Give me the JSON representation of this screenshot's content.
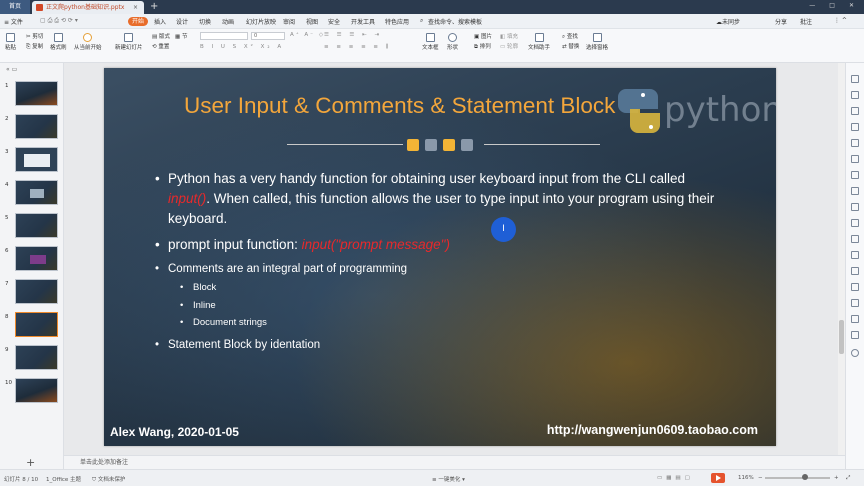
{
  "tabs": {
    "home": "首页",
    "document": "正文爬python基础知识.pptx"
  },
  "menu": {
    "file": "≡ 文件",
    "items": [
      "开始",
      "插入",
      "设计",
      "切换",
      "动画",
      "幻灯片放映",
      "审阅",
      "视图",
      "安全",
      "开发工具",
      "特色应用"
    ],
    "search": "查找命令、搜索模板",
    "sync": "未同步",
    "share": "分享",
    "annotate": "批注"
  },
  "ribbon": {
    "paste": "粘贴",
    "cut": "剪切",
    "copy": "复制",
    "format_painter": "格式刷",
    "from_current": "从当前开始",
    "new_slide": "新建幻灯片",
    "layout": "版式",
    "reset": "重置",
    "section": "节",
    "font_size": "0",
    "textbox": "文本框",
    "shape": "形状",
    "arrange": "排列",
    "picture": "图片",
    "fill": "填充",
    "outline": "轮廓",
    "doc_helper": "文档助手",
    "find_replace": "查找",
    "replace": "替换",
    "select_pane": "选择窗格"
  },
  "thumbnails": [
    "1",
    "2",
    "3",
    "4",
    "5",
    "6",
    "7",
    "8",
    "9",
    "10"
  ],
  "slide": {
    "title": "User Input & Comments & Statement Block",
    "python_word": "python",
    "bullet1_a": "Python has a very handy function for obtaining user keyboard input from the CLI called",
    "bullet1_red": "input()",
    "bullet1_b": ". When called, this function allows the user to type input into your program using their",
    "bullet1_c": "keyboard.",
    "bullet2_a": "prompt input function: ",
    "bullet2_red": "input(\"prompt message\")",
    "bullet3": "Comments are an integral part of programming",
    "sub1": "Block",
    "sub2": "Inline",
    "sub3": "Document strings",
    "bullet4": "Statement Block by identation",
    "footer_left": "Alex Wang,  2020-01-05",
    "footer_right": "http://wangwenjun0609.taobao.com",
    "cursor": "I",
    "colors": {
      "title": "#f3a63b",
      "red": "#e8292b",
      "square_gold": "#f3b436",
      "square_gray": "#8a99aa"
    }
  },
  "notes_placeholder": "单击此处添加备注",
  "status": {
    "slide_count": "幻灯片 8 / 10",
    "theme": "1_Office 主题",
    "protect": "文档未保护",
    "beautify": "一键美化",
    "zoom": "116%"
  }
}
